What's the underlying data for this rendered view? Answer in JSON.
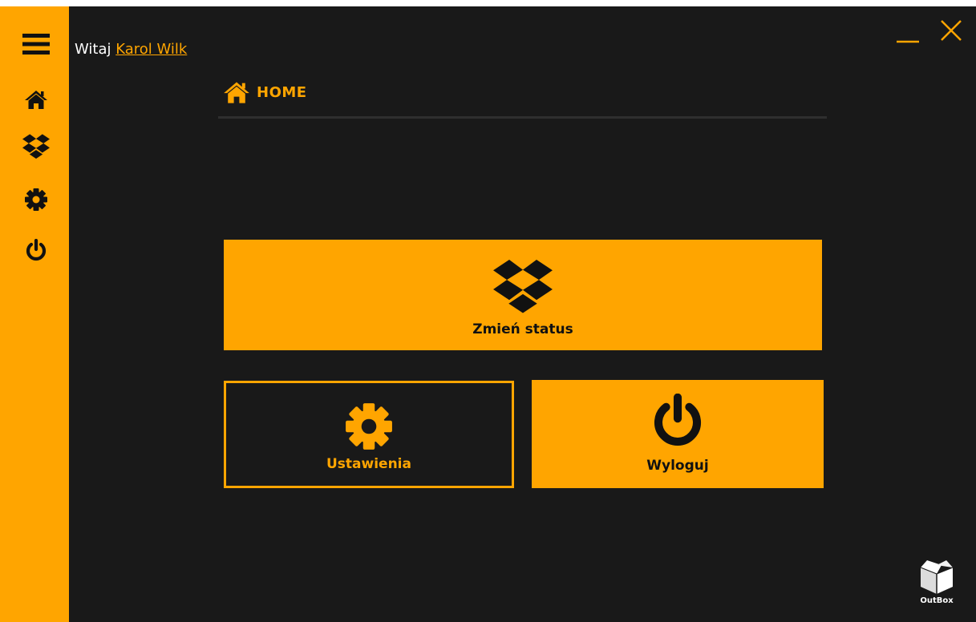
{
  "greeting": {
    "prefix": "Witaj ",
    "user_name": "Karol Wilk"
  },
  "sidebar": {
    "items": [
      {
        "icon": "menu-icon"
      },
      {
        "icon": "home-icon"
      },
      {
        "icon": "box-icon"
      },
      {
        "icon": "gear-icon"
      },
      {
        "icon": "power-icon"
      }
    ]
  },
  "window_controls": {
    "minimize": "minimize-icon",
    "close": "close-icon"
  },
  "page": {
    "title": "HOME",
    "icon": "home-icon"
  },
  "tiles": {
    "status": {
      "label": "Zmień status",
      "icon": "box-icon"
    },
    "settings": {
      "label": "Ustawienia",
      "icon": "gear-icon"
    },
    "logout": {
      "label": "Wyloguj",
      "icon": "power-icon"
    }
  },
  "logo": {
    "text": "OutBox"
  },
  "colors": {
    "accent": "#ffa500",
    "background": "#191919",
    "dark_icon": "#111111"
  }
}
